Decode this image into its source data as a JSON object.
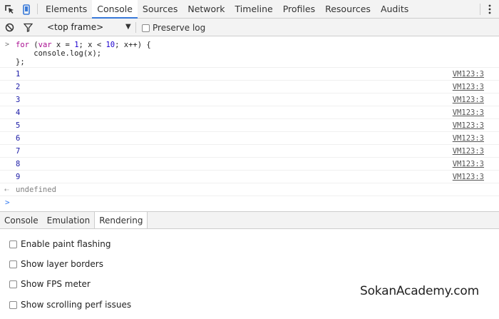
{
  "top_tabs": [
    "Elements",
    "Console",
    "Sources",
    "Network",
    "Timeline",
    "Profiles",
    "Resources",
    "Audits"
  ],
  "active_tab": "Console",
  "toolbar": {
    "frame": "<top frame>",
    "preserve_log": "Preserve log"
  },
  "console": {
    "input_lines": [
      "for (var x = 1; x < 10; x++) {",
      "    console.log(x);",
      "};"
    ],
    "logs": [
      {
        "value": "1",
        "source": "VM123:3"
      },
      {
        "value": "2",
        "source": "VM123:3"
      },
      {
        "value": "3",
        "source": "VM123:3"
      },
      {
        "value": "4",
        "source": "VM123:3"
      },
      {
        "value": "5",
        "source": "VM123:3"
      },
      {
        "value": "6",
        "source": "VM123:3"
      },
      {
        "value": "7",
        "source": "VM123:3"
      },
      {
        "value": "8",
        "source": "VM123:3"
      },
      {
        "value": "9",
        "source": "VM123:3"
      }
    ],
    "result": "undefined"
  },
  "drawer": {
    "tabs": [
      "Console",
      "Emulation",
      "Rendering"
    ],
    "active_tab": "Rendering",
    "options": [
      "Enable paint flashing",
      "Show layer borders",
      "Show FPS meter",
      "Show scrolling perf issues"
    ]
  },
  "watermark": "SokanAcademy.com",
  "colors": {
    "accent": "#3879d9",
    "log_value": "#1a1aa6",
    "keyword": "#aa0d91",
    "number": "#1c00cf"
  }
}
